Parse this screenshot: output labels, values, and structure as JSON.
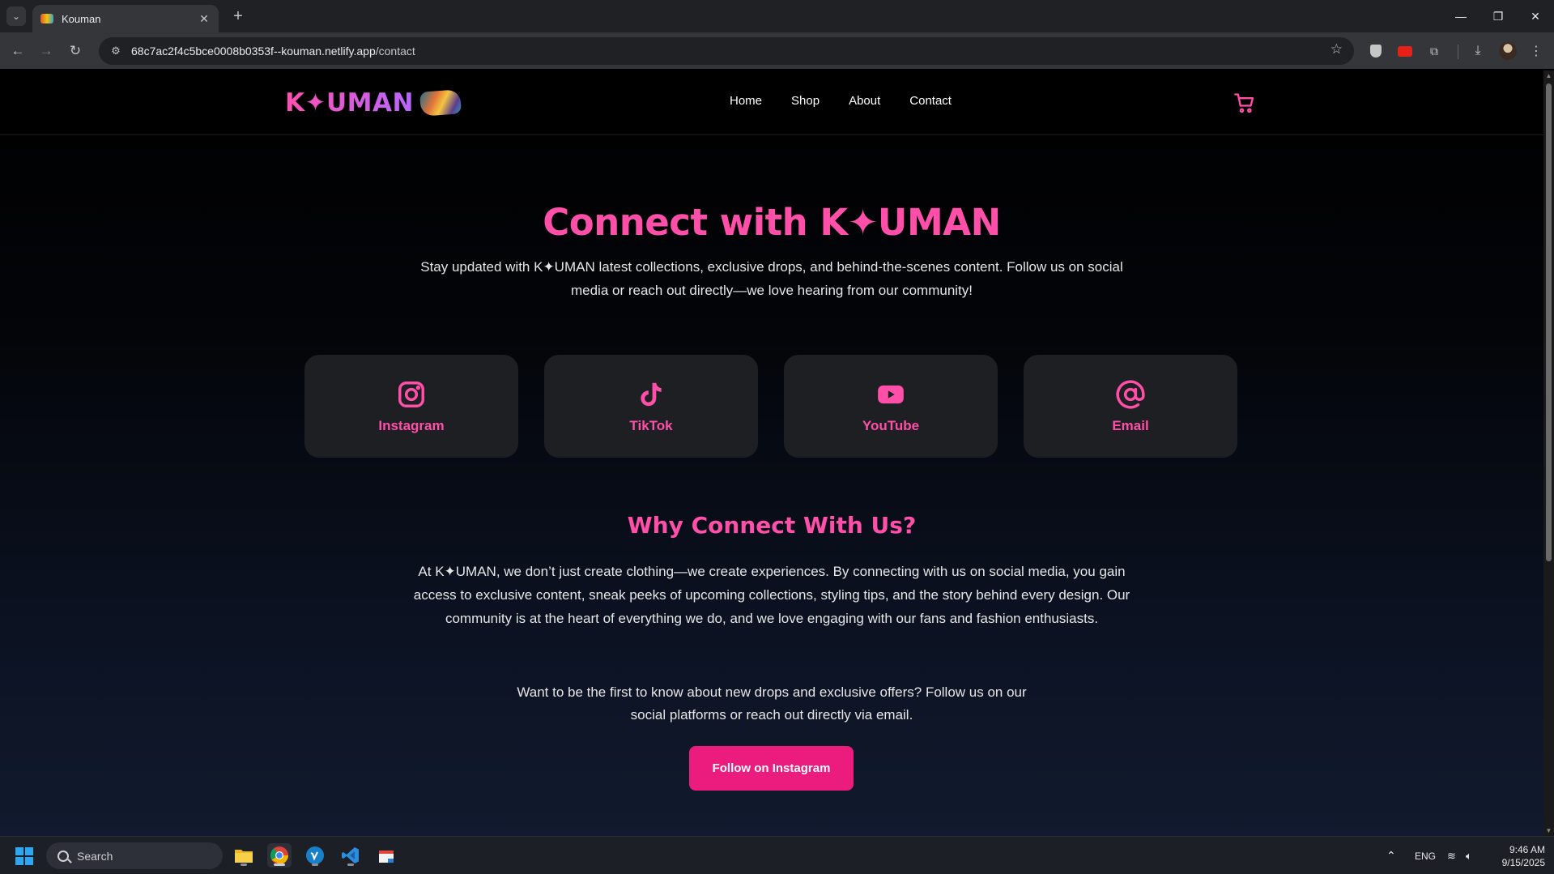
{
  "browser": {
    "tab_title": "Kouman",
    "url_host": "68c7ac2f4c5bce0008b0353f--kouman.netlify.app",
    "url_path": "/contact"
  },
  "site": {
    "logo_text": "K✦UMAN",
    "nav": [
      "Home",
      "Shop",
      "About",
      "Contact"
    ]
  },
  "hero": {
    "title": "Connect with K✦UMAN",
    "subtitle": "Stay updated with K✦UMAN latest collections, exclusive drops, and behind-the-scenes content. Follow us on social media or reach out directly—we love hearing from our community!"
  },
  "socials": [
    {
      "label": "Instagram",
      "icon": "instagram-icon"
    },
    {
      "label": "TikTok",
      "icon": "tiktok-icon"
    },
    {
      "label": "YouTube",
      "icon": "youtube-icon"
    },
    {
      "label": "Email",
      "icon": "at-sign-icon"
    }
  ],
  "why": {
    "title": "Why Connect With Us?",
    "body": "At K✦UMAN, we don’t just create clothing—we create experiences. By connecting with us on social media, you gain access to exclusive content, sneak peeks of upcoming collections, styling tips, and the story behind every design. Our community is at the heart of everything we do, and we love engaging with our fans and fashion enthusiasts."
  },
  "cta": {
    "text": "Want to be the first to know about new drops and exclusive offers? Follow us on our social platforms or reach out directly via email.",
    "button": "Follow on Instagram"
  },
  "taskbar": {
    "search_label": "Search",
    "language": "ENG",
    "time": "9:46 AM",
    "date": "9/15/2025"
  },
  "colors": {
    "accent_pink": "#ff4fa8",
    "button_pink": "#ec1b7e",
    "card_bg": "#1e1f23"
  }
}
